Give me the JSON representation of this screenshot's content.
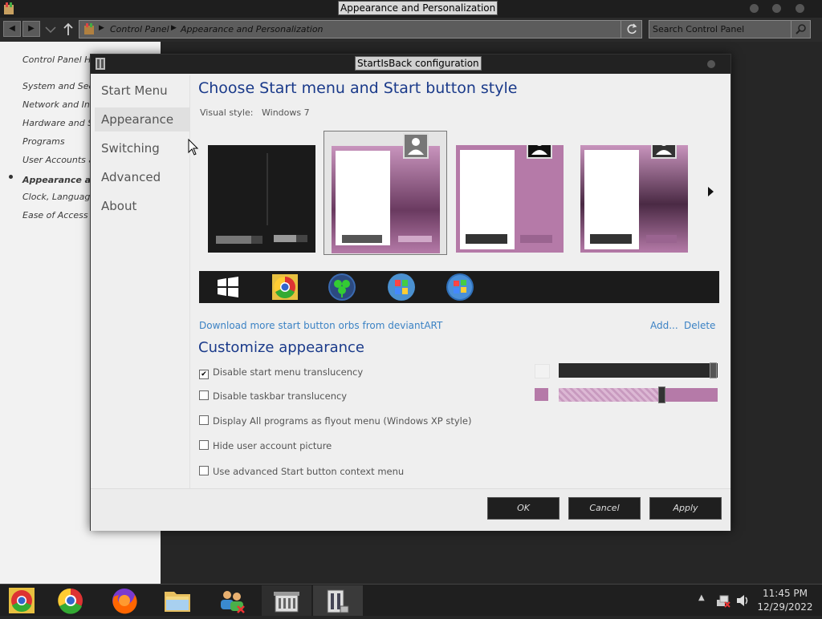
{
  "explorer": {
    "title": "Appearance and Personalization",
    "breadcrumb": [
      "Control Panel",
      "Appearance and Personalization"
    ],
    "search_placeholder": "Search Control Panel",
    "left_items": [
      "Control Panel Ho",
      "System and Secu",
      "Network and Inte",
      "Hardware and So",
      "Programs",
      "User Accounts an",
      "Appearance and",
      "Clock, Language,",
      "Ease of Access"
    ]
  },
  "dialog": {
    "title": "StartIsBack configuration",
    "nav": [
      "Start Menu",
      "Appearance",
      "Switching",
      "Advanced",
      "About"
    ],
    "selected_nav": "Appearance",
    "heading1": "Choose Start menu and Start button style",
    "visual_style_label": "Visual style:",
    "visual_style_value": "Windows 7",
    "download_link": "Download more start button orbs from deviantART",
    "add_link": "Add...",
    "delete_link": "Delete",
    "heading2": "Customize appearance",
    "options": [
      {
        "label": "Disable start menu translucency",
        "checked": true
      },
      {
        "label": "Disable taskbar translucency",
        "checked": false
      },
      {
        "label": "Display All programs as flyout menu (Windows XP style)",
        "checked": false
      },
      {
        "label": "Hide user account picture",
        "checked": false
      },
      {
        "label": "Use advanced Start button context menu",
        "checked": false
      }
    ],
    "ok_label": "OK",
    "cancel_label": "Cancel",
    "apply_label": "Apply"
  },
  "taskbar": {
    "time": "11:45 PM",
    "date": "12/29/2022"
  },
  "colors": {
    "accent_purple": "#b57aa8",
    "heading_blue": "#1a3a8a",
    "link_blue": "#3b82c4"
  }
}
